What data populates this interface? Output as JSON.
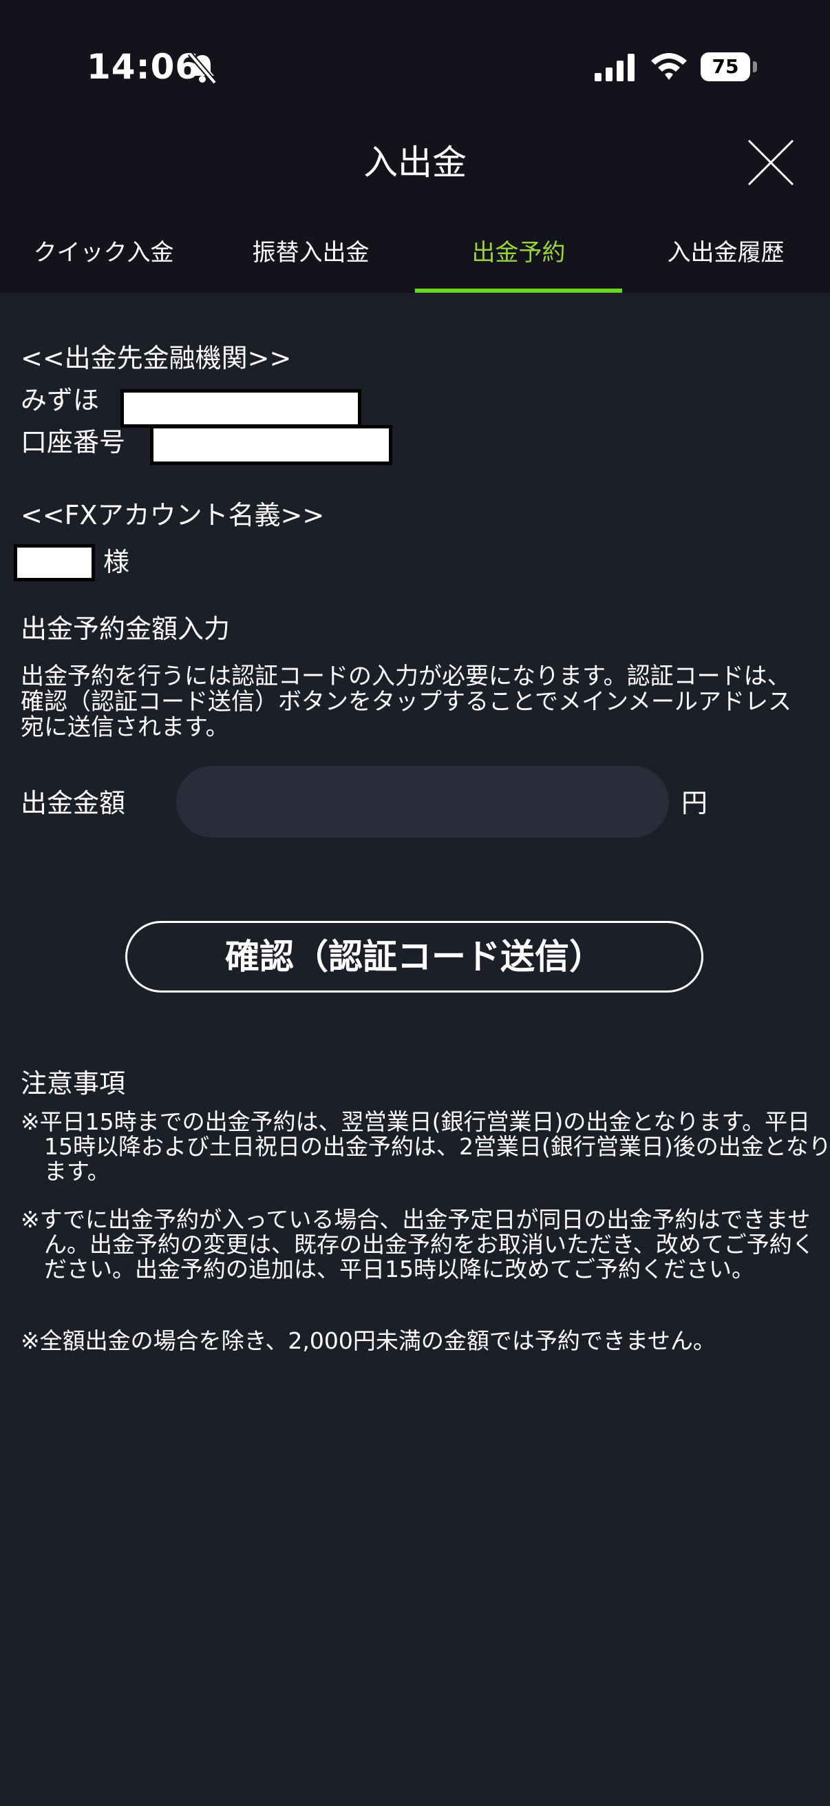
{
  "status_bar": {
    "time": "14:06",
    "battery": "75",
    "icons": [
      "bell-slash-icon",
      "signal-icon",
      "wifi-icon",
      "battery-icon"
    ]
  },
  "header": {
    "title": "入出金",
    "close_icon": "close-icon"
  },
  "tabs": [
    {
      "label": "クイック入金",
      "active": false
    },
    {
      "label": "振替入出金",
      "active": false
    },
    {
      "label": "出金予約",
      "active": true
    },
    {
      "label": "入出金履歴",
      "active": false
    }
  ],
  "bank": {
    "heading": "<<出金先金融機関>>",
    "bank_name": "みずほ",
    "account_label": "口座番号"
  },
  "fx_account": {
    "heading": "<<FXアカウント名義>>",
    "suffix": "様"
  },
  "amount_section": {
    "heading": "出金予約金額入力",
    "description": "出金予約を行うには認証コードの入力が必要になります。認証コードは、確認（認証コード送信）ボタンをタップすることでメインメールアドレス宛に送信されます。",
    "field_label": "出金金額",
    "field_value": "",
    "unit": "円",
    "confirm_button": "確認（認証コード送信）"
  },
  "notes": {
    "heading": "注意事項",
    "items": [
      "※平日15時までの出金予約は、翌営業日(銀行営業日)の出金となります。平日15時以降および土日祝日の出金予約は、2営業日(銀行営業日)後の出金となります。",
      "※すでに出金予約が入っている場合、出金予定日が同日の出金予約はできません。出金予約の変更は、既存の出金予約をお取消いただき、改めてご予約ください。出金予約の追加は、平日15時以降に改めてご予約ください。",
      "※全額出金の場合を除き、2,000円未満の金額では予約できません。"
    ]
  },
  "colors": {
    "background": "#1c1e28",
    "header_background": "#13141b",
    "accent": "#6cd61e",
    "active_tab_text": "#9ad33a",
    "field_background": "#2a2d39"
  }
}
